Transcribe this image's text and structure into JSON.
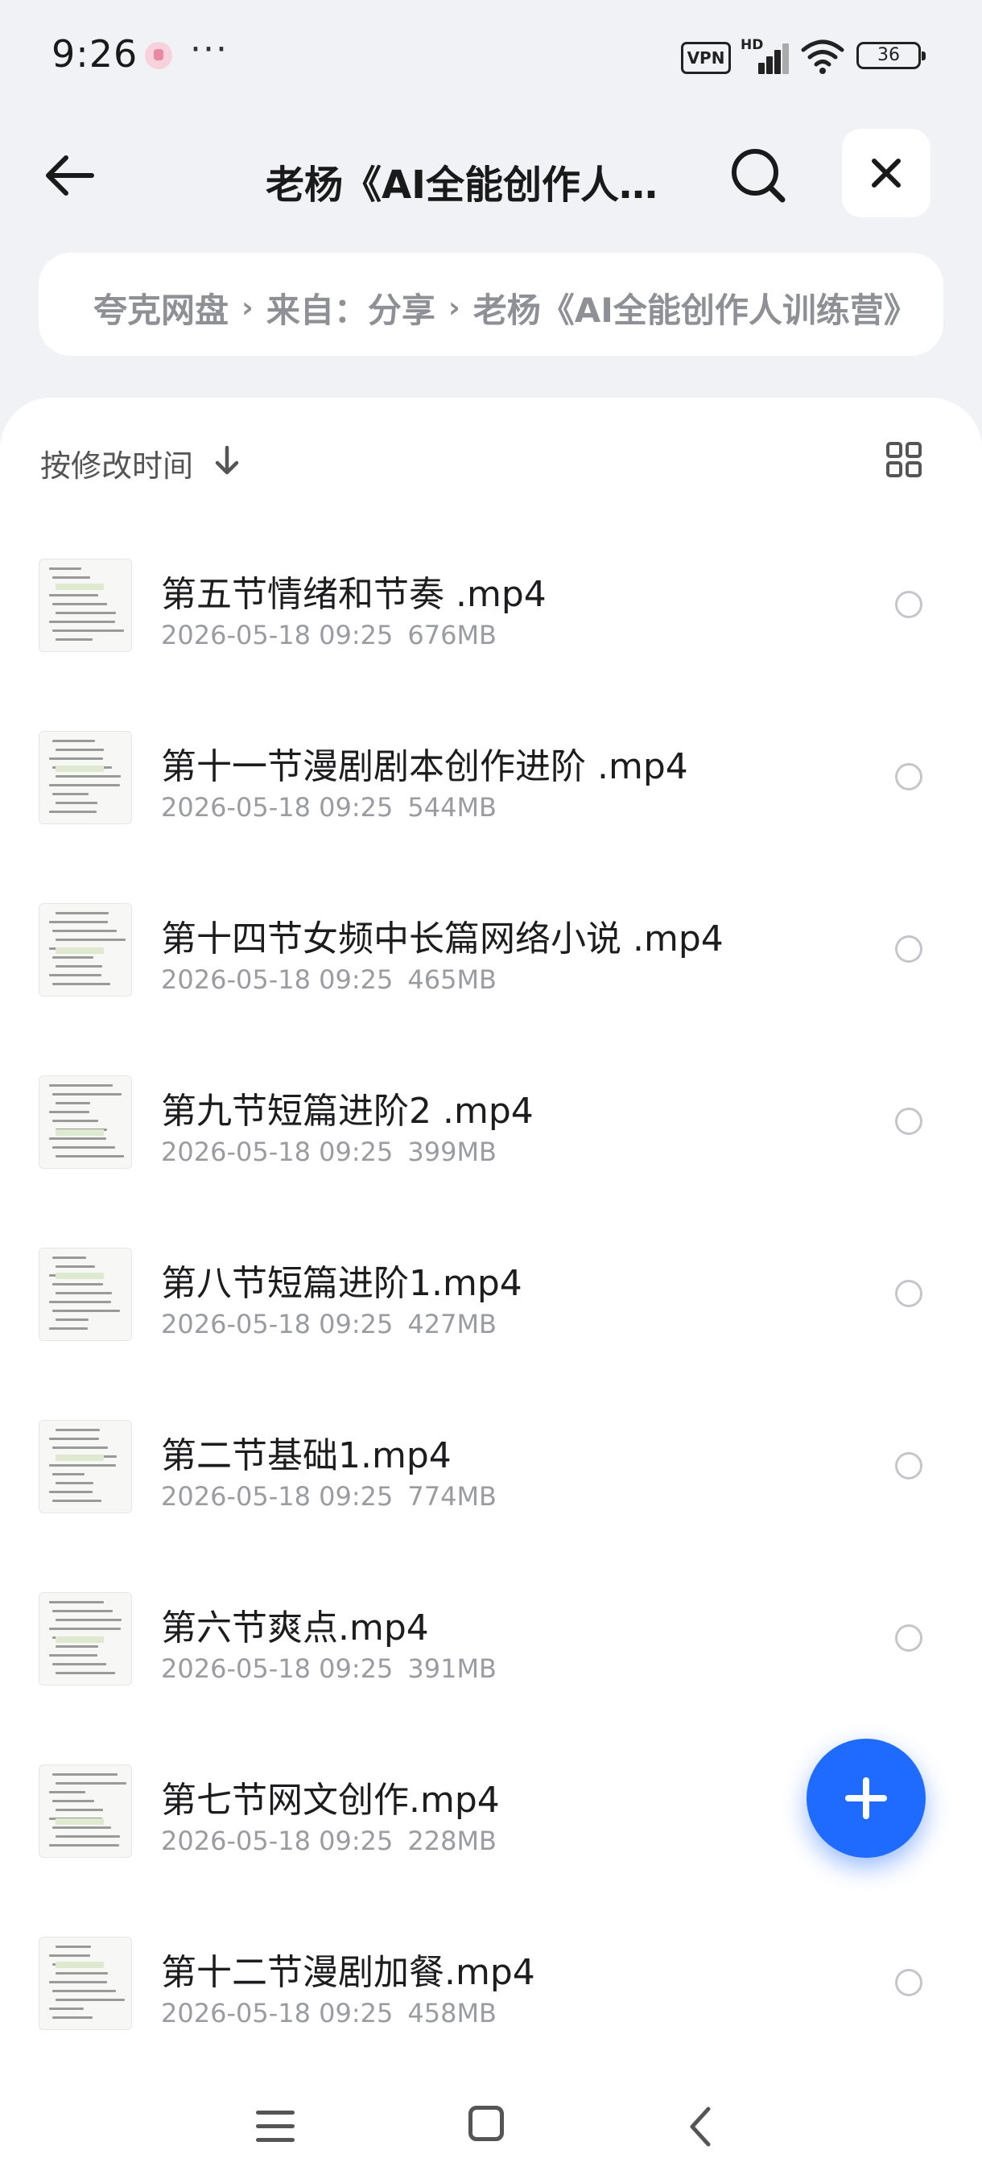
{
  "status_bar": {
    "time": "9:26",
    "dots": "···",
    "vpn": "VPN",
    "network": "HD",
    "battery": "36"
  },
  "header": {
    "title": "老杨《AI全能创作人训练营》",
    "title_display": "老杨《AI全能创作人…"
  },
  "breadcrumb": [
    "夸克网盘",
    "来自：分享",
    "老杨《AI全能创作人训练营》"
  ],
  "toolbar": {
    "sort_label": "按修改时间"
  },
  "files": [
    {
      "name": "第五节情绪和节奏 .mp4",
      "date": "2026-05-18 09:25",
      "size": "676MB"
    },
    {
      "name": "第十一节漫剧剧本创作进阶 .mp4",
      "date": "2026-05-18 09:25",
      "size": "544MB"
    },
    {
      "name": "第十四节女频中长篇网络小说 .mp4",
      "date": "2026-05-18 09:25",
      "size": "465MB"
    },
    {
      "name": "第九节短篇进阶2 .mp4",
      "date": "2026-05-18 09:25",
      "size": "399MB"
    },
    {
      "name": "第八节短篇进阶1.mp4",
      "date": "2026-05-18 09:25",
      "size": "427MB"
    },
    {
      "name": "第二节基础1.mp4",
      "date": "2026-05-18 09:25",
      "size": "774MB"
    },
    {
      "name": "第六节爽点.mp4",
      "date": "2026-05-18 09:25",
      "size": "391MB"
    },
    {
      "name": "第七节网文创作.mp4",
      "date": "2026-05-18 09:25",
      "size": "228MB"
    },
    {
      "name": "第十二节漫剧加餐.mp4",
      "date": "2026-05-18 09:25",
      "size": "458MB"
    }
  ],
  "colors": {
    "accent": "#1f6bff",
    "background": "#f1f2f5",
    "panel": "#ffffff",
    "meta_text": "#9a9ca1"
  }
}
